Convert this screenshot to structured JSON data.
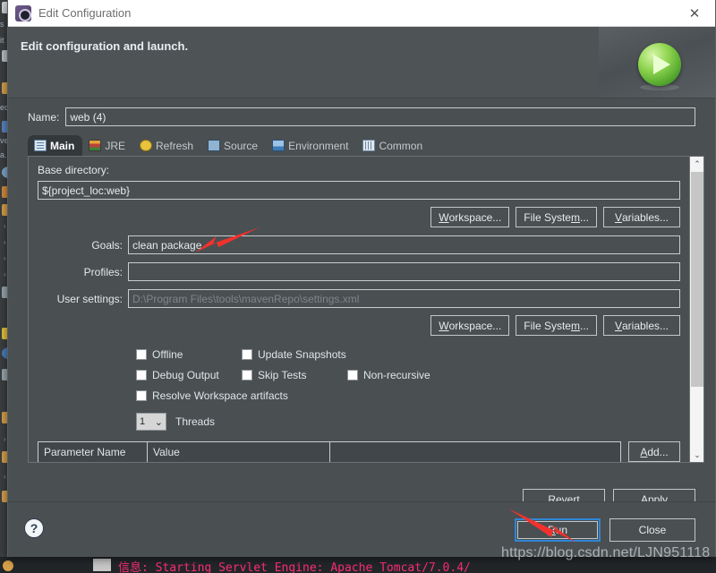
{
  "window": {
    "title": "Edit Configuration",
    "title_icon": "gear-icon",
    "close_icon": "✕"
  },
  "header": {
    "title": "Edit configuration and launch.",
    "banner_icon": "run-play-icon"
  },
  "name_row": {
    "label": "Name:",
    "value": "web (4)"
  },
  "tabs": [
    {
      "label": "Main",
      "icon": "main-tab-icon",
      "active": true
    },
    {
      "label": "JRE",
      "icon": "jre-tab-icon",
      "active": false
    },
    {
      "label": "Refresh",
      "icon": "refresh-tab-icon",
      "active": false
    },
    {
      "label": "Source",
      "icon": "source-tab-icon",
      "active": false
    },
    {
      "label": "Environment",
      "icon": "environment-tab-icon",
      "active": false
    },
    {
      "label": "Common",
      "icon": "common-tab-icon",
      "active": false
    }
  ],
  "main_tab": {
    "base_directory": {
      "label": "Base directory:",
      "value": "${project_loc:web}"
    },
    "path_buttons": [
      {
        "label": "Workspace...",
        "mnemonic": "W"
      },
      {
        "label": "File System...",
        "mnemonic": "m"
      },
      {
        "label": "Variables...",
        "mnemonic": "V"
      }
    ],
    "goals": {
      "label": "Goals:",
      "value": "clean package"
    },
    "profiles": {
      "label": "Profiles:",
      "value": ""
    },
    "user_settings": {
      "label": "User settings:",
      "placeholder": "D:\\Program Files\\tools\\mavenRepo\\settings.xml"
    },
    "settings_buttons": [
      {
        "label": "Workspace...",
        "mnemonic": "W"
      },
      {
        "label": "File System...",
        "mnemonic": "m"
      },
      {
        "label": "Variables...",
        "mnemonic": "V"
      }
    ],
    "checkboxes": [
      [
        {
          "label": "Offline",
          "checked": false
        },
        {
          "label": "Update Snapshots",
          "checked": false
        }
      ],
      [
        {
          "label": "Debug Output",
          "checked": false
        },
        {
          "label": "Skip Tests",
          "checked": false
        },
        {
          "label": "Non-recursive",
          "checked": false
        }
      ],
      [
        {
          "label": "Resolve Workspace artifacts",
          "checked": false
        }
      ]
    ],
    "threads": {
      "value": "1",
      "label": "Threads",
      "chevron": "⌄"
    },
    "parameter_table": {
      "columns": [
        "Parameter Name",
        "Value",
        ""
      ],
      "rows": []
    },
    "add_button": {
      "label": "Add...",
      "mnemonic": "A"
    },
    "scrollbar": {
      "up": "⌃",
      "down": "⌄"
    }
  },
  "apply_row": {
    "revert": "Revert",
    "apply": "Apply"
  },
  "footer": {
    "help_icon": "?",
    "run": "Run",
    "close": "Close"
  },
  "annotations": {
    "arrow_goals": "red-arrow-pointing-at-goals",
    "arrow_run": "red-arrow-pointing-at-run"
  },
  "watermark": "https://blog.csdn.net/LJN951118",
  "ide_background": {
    "rail_labels": [
      "s",
      "it",
      "ec",
      "ve",
      "a.1"
    ],
    "console_line": "信息: Starting Servlet Engine: Apache Tomcat/7.0.4/"
  },
  "colors": {
    "dialog_bg": "#4a4f52",
    "titlebar_bg": "#ffffff",
    "accent_focus": "#2f86d6",
    "annotation_red": "#f3312c",
    "console_text": "#ff2d78",
    "run_green": "#6fc13a"
  }
}
